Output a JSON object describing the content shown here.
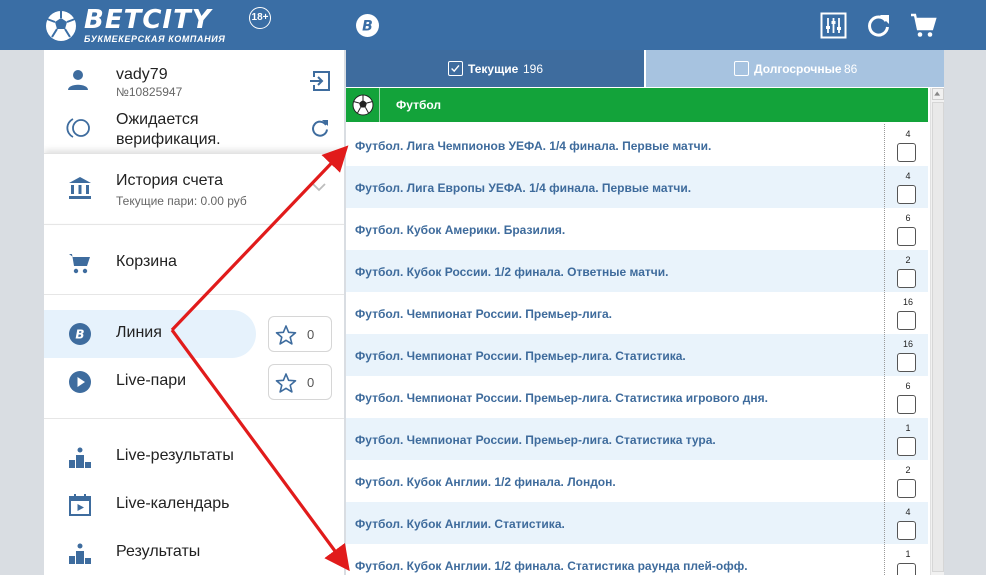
{
  "header": {
    "logo_text": "BETCITY",
    "logo_sub": "БУКМЕКЕРСКАЯ КОМПАНИЯ",
    "age_badge": "18+",
    "icons": [
      "betcity-b-icon",
      "settings-sliders-icon",
      "refresh-icon",
      "cart-icon"
    ]
  },
  "user": {
    "name": "vady79",
    "id": "№10825947",
    "verification": "Ожидается верификация."
  },
  "history": {
    "title": "История счета",
    "subtitle": "Текущие пари: 0.00 руб"
  },
  "menu": {
    "cart": "Корзина",
    "line": "Линия",
    "line_fav": "0",
    "live": "Live-пари",
    "live_fav": "0",
    "live_results": "Live-результаты",
    "live_calendar": "Live-календарь",
    "results": "Результаты"
  },
  "tabs": {
    "current_label": "Текущие",
    "current_count": "196",
    "long_label": "Долгосрочные",
    "long_count": "86"
  },
  "sport": {
    "label": "Футбол"
  },
  "rows": [
    {
      "name": "Футбол. Лига Чемпионов УЕФА. 1/4 финала. Первые матчи.",
      "count": "4"
    },
    {
      "name": "Футбол. Лига Европы УЕФА. 1/4 финала. Первые матчи.",
      "count": "4"
    },
    {
      "name": "Футбол. Кубок Америки. Бразилия.",
      "count": "6"
    },
    {
      "name": "Футбол. Кубок России. 1/2 финала. Ответные матчи.",
      "count": "2"
    },
    {
      "name": "Футбол. Чемпионат России. Премьер-лига.",
      "count": "16"
    },
    {
      "name": "Футбол. Чемпионат России. Премьер-лига. Статистика.",
      "count": "16"
    },
    {
      "name": "Футбол. Чемпионат России. Премьер-лига. Статистика игрового дня.",
      "count": "6"
    },
    {
      "name": "Футбол. Чемпионат России. Премьер-лига. Статистика тура.",
      "count": "1"
    },
    {
      "name": "Футбол. Кубок Англии. 1/2 финала. Лондон.",
      "count": "2"
    },
    {
      "name": "Футбол. Кубок Англии. Статистика.",
      "count": "4"
    },
    {
      "name": "Футбол. Кубок Англии. 1/2 финала. Статистика раунда плей-офф.",
      "count": "1"
    }
  ],
  "colors": {
    "header": "#3a6ea5",
    "tab_active": "#3e6c9e",
    "tab_inactive": "#a7c3e0",
    "sport_bar": "#13a33a",
    "row_text": "#3e6b9c",
    "arrow": "#e11b1b"
  }
}
